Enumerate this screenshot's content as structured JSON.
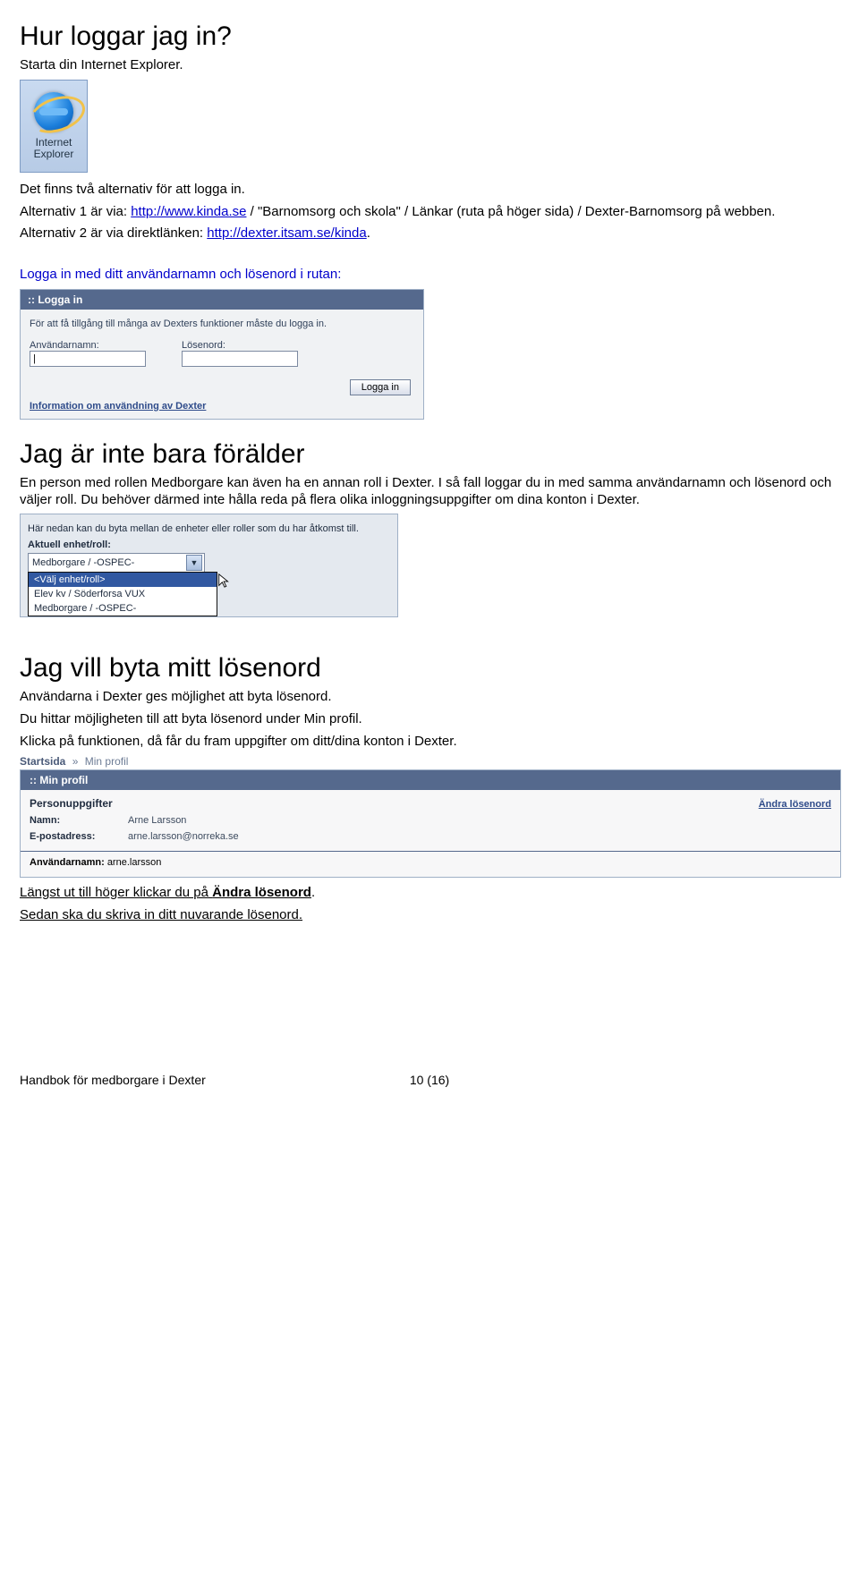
{
  "page": {
    "h1": "Hur loggar jag in?",
    "p_start": "Starta din Internet Explorer.",
    "ie_label_line1": "Internet",
    "ie_label_line2": "Explorer",
    "p_two_alt": "Det finns två alternativ för att logga in.",
    "alt1_prefix": "Alternativ 1 är via: ",
    "alt1_url": "http://www.kinda.se",
    "alt1_rest": " / \"Barnomsorg och skola\" / Länkar (ruta på höger sida) / Dexter-Barnomsorg på webben.",
    "alt2_prefix": "Alternativ 2 är via direktlänken: ",
    "alt2_url": "http://dexter.itsam.se/kinda",
    "alt2_dot": ".",
    "login_caption": "Logga in med ditt användarnamn och lösenord i rutan:"
  },
  "login_panel": {
    "title": ":: Logga in",
    "desc": "För att få tillgång till många av Dexters funktioner måste du logga in.",
    "user_label": "Användarnamn:",
    "pwd_label": "Lösenord:",
    "user_value": "|",
    "btn": "Logga in",
    "info_link": "Information om användning av Dexter"
  },
  "section2": {
    "h": "Jag är inte bara förälder",
    "p": "En person med rollen Medborgare kan även ha en annan roll i Dexter. I så fall loggar du in med samma användarnamn och lösenord och väljer roll. Du behöver därmed inte hålla reda på flera olika inloggningsuppgifter om dina konton i Dexter."
  },
  "role": {
    "intro": "Här nedan kan du byta mellan de enheter eller roller som du har åtkomst till.",
    "label": "Aktuell enhet/roll:",
    "selected": "Medborgare / -OSPEC-",
    "options": [
      "<Välj enhet/roll>",
      "Elev kv / Söderforsa VUX",
      "Medborgare / -OSPEC-"
    ]
  },
  "section3": {
    "h": "Jag vill byta mitt lösenord",
    "p1": "Användarna i Dexter ges möjlighet att byta lösenord.",
    "p2": "Du hittar möjligheten till att byta lösenord under Min profil.",
    "p3": "Klicka på funktionen, då får du fram uppgifter om ditt/dina konton i Dexter."
  },
  "breadcrumb": {
    "a": "Startsida",
    "sep": "»",
    "b": "Min profil"
  },
  "profile": {
    "title": ":: Min profil",
    "section_title": "Personuppgifter",
    "change_pw": "Ändra lösenord",
    "name_k": "Namn:",
    "name_v": "Arne Larsson",
    "mail_k": "E-postadress:",
    "mail_v": "arne.larsson@norreka.se",
    "user_k": "Användarnamn:",
    "user_v": "arne.larsson"
  },
  "tail": {
    "line1_a": "Längst ut till höger klickar du på ",
    "line1_b": "Ändra lösenord",
    "line1_c": ".",
    "line2": "Sedan ska du skriva in ditt nuvarande lösenord."
  },
  "footer": {
    "left": "Handbok för medborgare i Dexter",
    "page": "10 (16)"
  }
}
